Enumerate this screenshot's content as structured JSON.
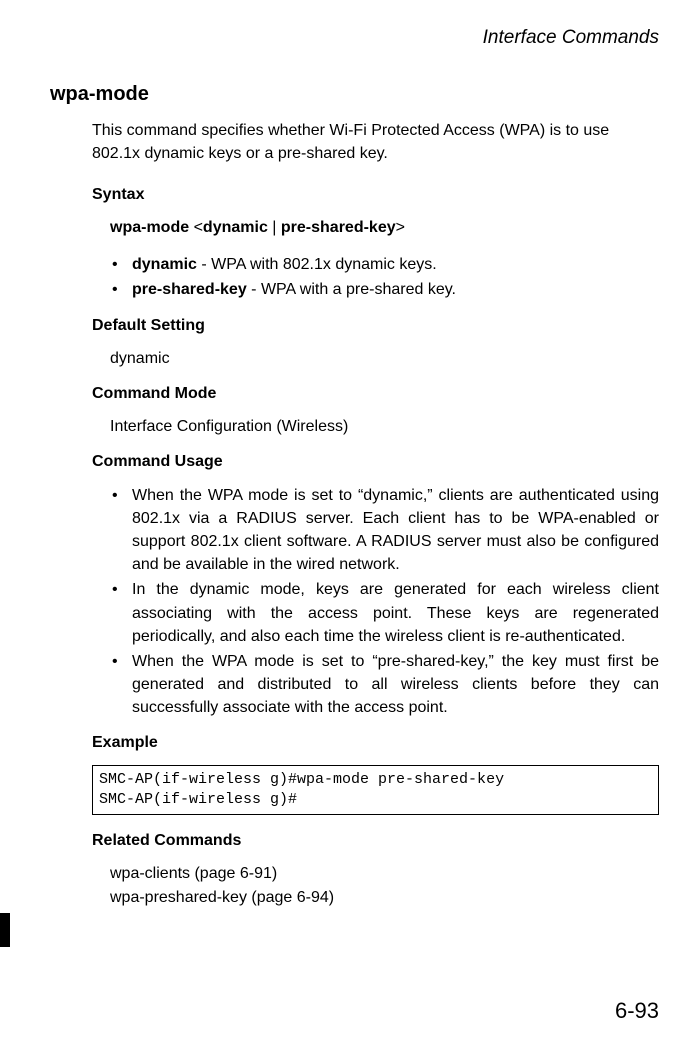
{
  "header": "Interface Commands",
  "commandTitle": "wpa-mode",
  "description": "This command specifies whether Wi-Fi Protected Access (WPA) is to use 802.1x dynamic keys or a pre-shared key.",
  "syntax": {
    "heading": "Syntax",
    "cmd": "wpa-mode",
    "lt": "<",
    "opt1": "dynamic",
    "pipe": " | ",
    "opt2": "pre-shared-key",
    "gt": ">",
    "params": [
      {
        "name": "dynamic",
        "desc": " - WPA with 802.1x dynamic keys."
      },
      {
        "name": "pre-shared-key",
        "desc": " - WPA with a pre-shared key."
      }
    ]
  },
  "defaultSetting": {
    "heading": "Default Setting",
    "value": "dynamic"
  },
  "commandMode": {
    "heading": "Command Mode",
    "value": "Interface Configuration (Wireless)"
  },
  "commandUsage": {
    "heading": "Command Usage",
    "items": [
      "When the WPA mode is set to “dynamic,” clients are authenticated using 802.1x via a RADIUS server. Each client has to be WPA-enabled or support 802.1x client software. A RADIUS server must also be configured and be available in the wired network.",
      "In the dynamic mode, keys are generated for each wireless client associating with the access point. These keys are regenerated periodically, and also each time the wireless client is re-authenticated.",
      "When the WPA mode is set to “pre-shared-key,” the key must first be generated and distributed to all wireless clients before they can successfully associate with the access point."
    ]
  },
  "example": {
    "heading": "Example",
    "line1": "SMC-AP(if-wireless g)#wpa-mode pre-shared-key",
    "line2": "SMC-AP(if-wireless g)#"
  },
  "relatedCommands": {
    "heading": "Related Commands",
    "items": [
      "wpa-clients (page 6-91)",
      "wpa-preshared-key (page 6-94)"
    ]
  },
  "pageNumber": "6-93"
}
